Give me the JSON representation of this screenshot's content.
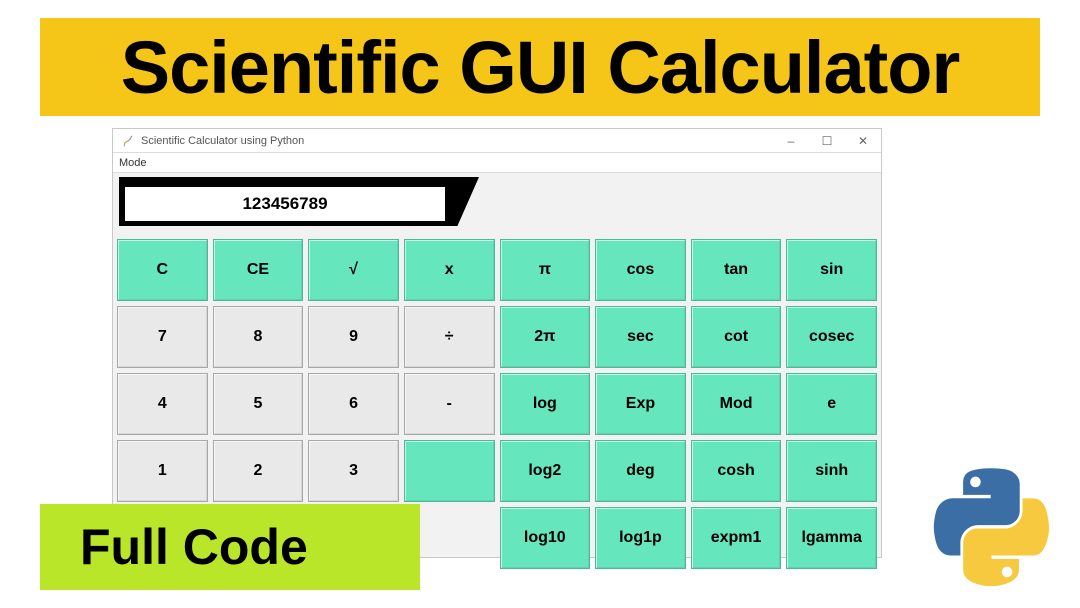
{
  "banner": {
    "title": "Scientific GUI Calculator"
  },
  "window": {
    "title": "Scientific Calculator using Python",
    "menu": {
      "mode": "Mode"
    },
    "controls": {
      "min": "–",
      "max": "☐",
      "close": "✕"
    }
  },
  "display": {
    "value": "123456789"
  },
  "buttons": {
    "rows": [
      [
        {
          "label": "C",
          "style": "mint",
          "name": "clear"
        },
        {
          "label": "CE",
          "style": "mint",
          "name": "clear-entry"
        },
        {
          "label": "√",
          "style": "mint",
          "name": "sqrt"
        },
        {
          "label": "x",
          "style": "mint",
          "name": "multiply"
        },
        {
          "label": "π",
          "style": "mint",
          "name": "pi"
        },
        {
          "label": "cos",
          "style": "mint",
          "name": "cos"
        },
        {
          "label": "tan",
          "style": "mint",
          "name": "tan"
        },
        {
          "label": "sin",
          "style": "mint",
          "name": "sin"
        }
      ],
      [
        {
          "label": "7",
          "style": "gray",
          "name": "digit-7"
        },
        {
          "label": "8",
          "style": "gray",
          "name": "digit-8"
        },
        {
          "label": "9",
          "style": "gray",
          "name": "digit-9"
        },
        {
          "label": "÷",
          "style": "gray",
          "name": "divide"
        },
        {
          "label": "2π",
          "style": "mint",
          "name": "two-pi"
        },
        {
          "label": "sec",
          "style": "mint",
          "name": "sec"
        },
        {
          "label": "cot",
          "style": "mint",
          "name": "cot"
        },
        {
          "label": "cosec",
          "style": "mint",
          "name": "cosec"
        }
      ],
      [
        {
          "label": "4",
          "style": "gray",
          "name": "digit-4"
        },
        {
          "label": "5",
          "style": "gray",
          "name": "digit-5"
        },
        {
          "label": "6",
          "style": "gray",
          "name": "digit-6"
        },
        {
          "label": "-",
          "style": "gray",
          "name": "subtract"
        },
        {
          "label": "log",
          "style": "mint",
          "name": "log"
        },
        {
          "label": "Exp",
          "style": "mint",
          "name": "exp"
        },
        {
          "label": "Mod",
          "style": "mint",
          "name": "mod"
        },
        {
          "label": "e",
          "style": "mint",
          "name": "e"
        }
      ],
      [
        {
          "label": "1",
          "style": "gray",
          "name": "digit-1"
        },
        {
          "label": "2",
          "style": "gray",
          "name": "digit-2"
        },
        {
          "label": "3",
          "style": "gray",
          "name": "digit-3"
        },
        {
          "label": "",
          "style": "mint",
          "name": "add",
          "hidden": false
        },
        {
          "label": "log2",
          "style": "mint",
          "name": "log2"
        },
        {
          "label": "deg",
          "style": "mint",
          "name": "deg"
        },
        {
          "label": "cosh",
          "style": "mint",
          "name": "cosh"
        },
        {
          "label": "sinh",
          "style": "mint",
          "name": "sinh"
        }
      ],
      [
        {
          "label": "",
          "style": "gray",
          "name": "digit-0",
          "hidden": true
        },
        {
          "label": "",
          "style": "gray",
          "name": "decimal",
          "hidden": true
        },
        {
          "label": "",
          "style": "gray",
          "name": "equals",
          "hidden": true
        },
        {
          "label": "",
          "style": "gray",
          "name": "blank",
          "hidden": true
        },
        {
          "label": "log10",
          "style": "mint",
          "name": "log10"
        },
        {
          "label": "log1p",
          "style": "mint",
          "name": "log1p"
        },
        {
          "label": "expm1",
          "style": "mint",
          "name": "expm1"
        },
        {
          "label": "lgamma",
          "style": "mint",
          "name": "lgamma"
        }
      ]
    ]
  },
  "footer": {
    "label": "Full Code"
  },
  "logo": {
    "name": "python-logo-icon"
  }
}
